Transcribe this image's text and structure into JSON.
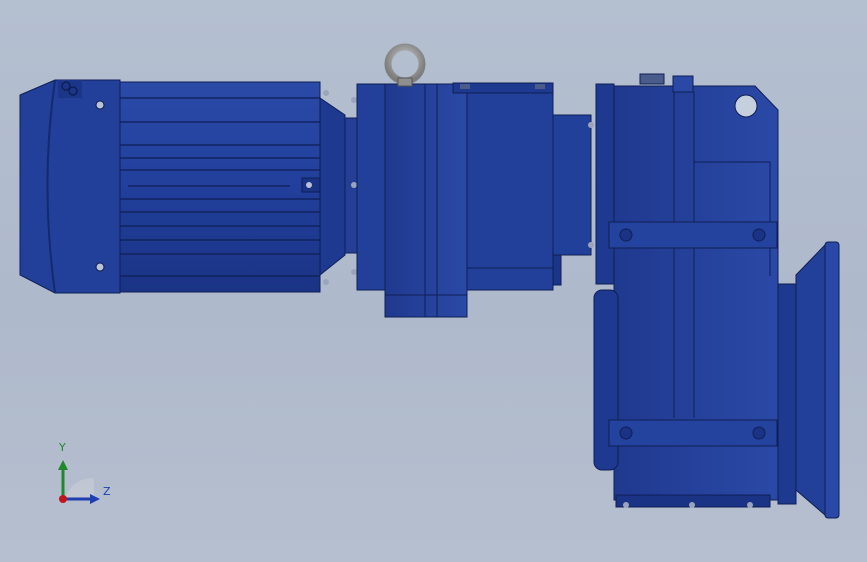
{
  "viewport": {
    "background_top": "#b4bfd0",
    "background_bottom": "#b6bfcf"
  },
  "model": {
    "body_color": "#22409a",
    "dark_color": "#142a6e",
    "light_color": "#3a5cc0",
    "lifting_eye_color": "#9a9a9a",
    "parts": [
      "motor",
      "motor-fan-cover",
      "adapter-flange",
      "primary-gear-stage",
      "coupling-housing",
      "main-gearbox",
      "output-flange",
      "lifting-eye",
      "mounting-brackets"
    ]
  },
  "triad": {
    "y_label": "Y",
    "z_label": "Z",
    "y_color": "#1f8a2a",
    "z_color": "#1d3fb0",
    "origin_color": "#c0161b"
  }
}
